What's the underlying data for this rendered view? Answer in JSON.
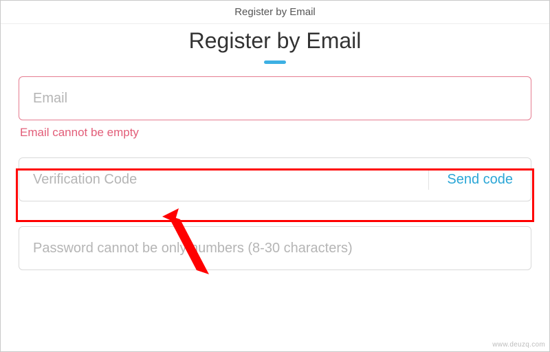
{
  "topbar": {
    "title": "Register by Email"
  },
  "page": {
    "heading": "Register by Email"
  },
  "email": {
    "placeholder": "Email",
    "value": "",
    "error": "Email cannot be empty"
  },
  "code": {
    "placeholder": "Verification Code",
    "value": "",
    "send_label": "Send code"
  },
  "password": {
    "placeholder": "Password cannot be only numbers (8-30 characters)",
    "value": ""
  },
  "watermark": "www.deuzq.com",
  "annotation": {
    "highlight_target": "verification-code-field",
    "arrow_points_to": "verification-code-input"
  }
}
